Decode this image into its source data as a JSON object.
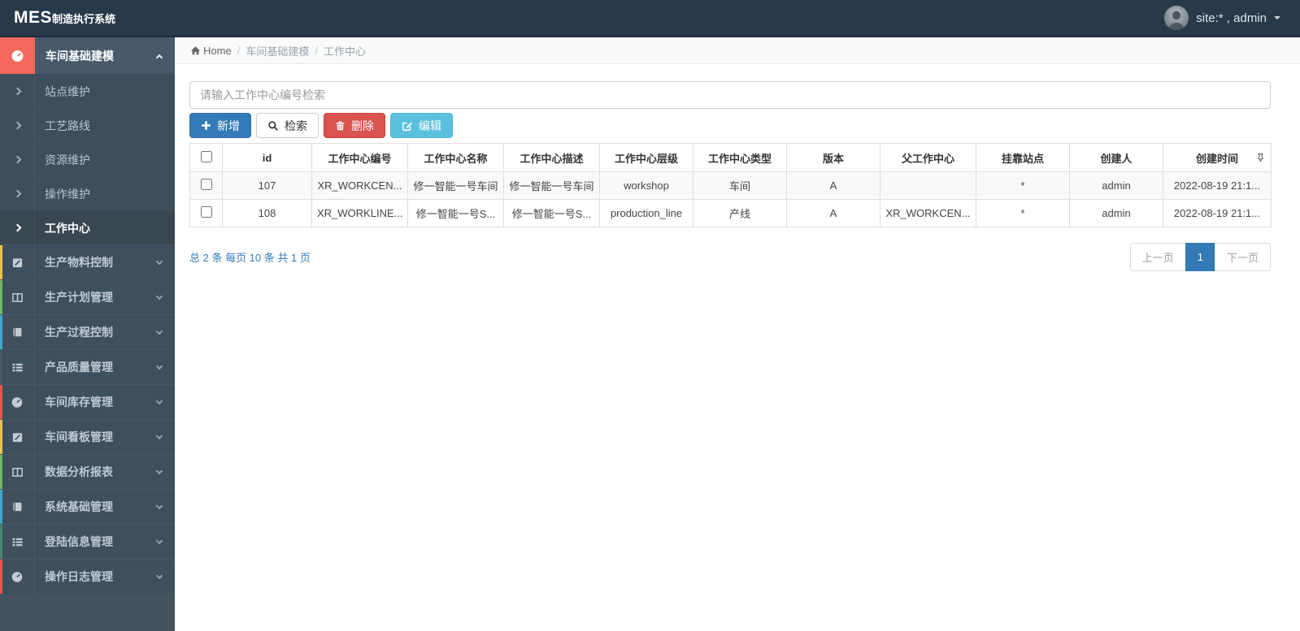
{
  "navbar": {
    "logo_mes": "MES",
    "logo_rest": "制造执行系统",
    "user": "site:* , admin"
  },
  "breadcrumb": {
    "home": "Home",
    "sep": "/",
    "items": [
      "车间基础建模",
      "工作中心"
    ]
  },
  "sidebar": {
    "parent": {
      "label": "车间基础建模",
      "icon": "dashboard-icon",
      "accent": "#f4695c"
    },
    "subitems": [
      {
        "label": "站点维护",
        "active": false
      },
      {
        "label": "工艺路线",
        "active": false
      },
      {
        "label": "资源维护",
        "active": false
      },
      {
        "label": "操作维护",
        "active": false
      },
      {
        "label": "工作中心",
        "active": true
      }
    ],
    "items": [
      {
        "label": "生产物料控制",
        "icon": "pencil-square-icon",
        "strip": "#edc252"
      },
      {
        "label": "生产计划管理",
        "icon": "columns-icon",
        "strip": "#74b567"
      },
      {
        "label": "生产过程控制",
        "icon": "book-icon",
        "strip": "#41a8c8"
      },
      {
        "label": "产品质量管理",
        "icon": "list-icon",
        "strip": "#46596b"
      },
      {
        "label": "车间库存管理",
        "icon": "dashboard-icon",
        "strip": "#e2574f"
      },
      {
        "label": "车间看板管理",
        "icon": "pencil-square-icon",
        "strip": "#edc252"
      },
      {
        "label": "数据分析报表",
        "icon": "columns-icon",
        "strip": "#74b567"
      },
      {
        "label": "系统基础管理",
        "icon": "book-icon",
        "strip": "#41a8c8"
      },
      {
        "label": "登陆信息管理",
        "icon": "list-icon",
        "strip": "#4b8273"
      },
      {
        "label": "操作日志管理",
        "icon": "dashboard-icon",
        "strip": "#e2574f"
      }
    ]
  },
  "toolbar": {
    "search_placeholder": "请输入工作中心编号检索",
    "add_label": "新增",
    "search_label": "检索",
    "delete_label": "删除",
    "edit_label": "编辑"
  },
  "table": {
    "columns": [
      "id",
      "工作中心编号",
      "工作中心名称",
      "工作中心描述",
      "工作中心层级",
      "工作中心类型",
      "版本",
      "父工作中心",
      "挂靠站点",
      "创建人",
      "创建时间"
    ],
    "rows": [
      [
        "107",
        "XR_WORKCEN...",
        "修一智能一号车间",
        "修一智能一号车间",
        "workshop",
        "车间",
        "A",
        "",
        "*",
        "admin",
        "2022-08-19 21:1..."
      ],
      [
        "108",
        "XR_WORKLINE...",
        "修一智能一号S...",
        "修一智能一号S...",
        "production_line",
        "产线",
        "A",
        "XR_WORKCEN...",
        "*",
        "admin",
        "2022-08-19 21:1..."
      ]
    ]
  },
  "pagination": {
    "summary": "总 2 条 每页 10 条 共 1 页",
    "prev": "上一页",
    "current": "1",
    "next": "下一页"
  },
  "colors": {
    "navbar_bg": "#28394a",
    "sidebar_bg": "#42525f",
    "active_accent": "#f4695c",
    "primary": "#337ab7",
    "danger": "#d9534f",
    "info": "#5bc0de",
    "link": "#337ab7"
  }
}
